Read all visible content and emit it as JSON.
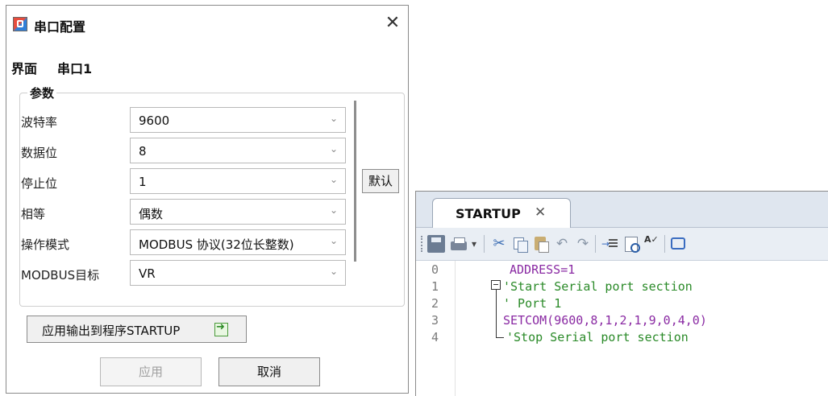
{
  "dialog": {
    "title": "串口配置",
    "close_glyph": "✕",
    "interface_label": "界面",
    "interface_value": "串口1",
    "group_title": "参数",
    "fields": [
      {
        "label": "波特率",
        "value": "9600"
      },
      {
        "label": "数据位",
        "value": "8"
      },
      {
        "label": "停止位",
        "value": "1"
      },
      {
        "label": "相等",
        "value": "偶数"
      },
      {
        "label": "操作模式",
        "value": "MODBUS 协议(32位长整数)"
      },
      {
        "label": "MODBUS目标",
        "value": "VR"
      }
    ],
    "default_button": "默认",
    "apply_output_button": "应用输出到程序STARTUP",
    "apply_button": "应用",
    "cancel_button": "取消"
  },
  "editor": {
    "tab_label": "STARTUP",
    "tab_close": "✕",
    "toolbar_glyphs": {
      "cut": "✂",
      "undo": "↶",
      "redo": "↷",
      "dropdown": "▾",
      "indent": "→",
      "spell": "A✓"
    },
    "line_numbers": [
      "0",
      "1",
      "2",
      "3",
      "4"
    ],
    "lines": [
      "ADDRESS=1",
      "'Start Serial port section",
      "' Port 1",
      "SETCOM(9600,8,1,2,1,9,0,4,0)",
      "'Stop Serial port section"
    ]
  },
  "colors": {
    "keyword": "#8a2aa3",
    "comment": "#2a8a28"
  },
  "icons": [
    "app-icon",
    "close-icon",
    "chevron-down-icon",
    "export-icon",
    "save-icon",
    "print-icon",
    "cut-icon",
    "copy-icon",
    "paste-icon",
    "undo-icon",
    "redo-icon",
    "indent-icon",
    "find-icon",
    "spellcheck-icon",
    "box-icon"
  ]
}
